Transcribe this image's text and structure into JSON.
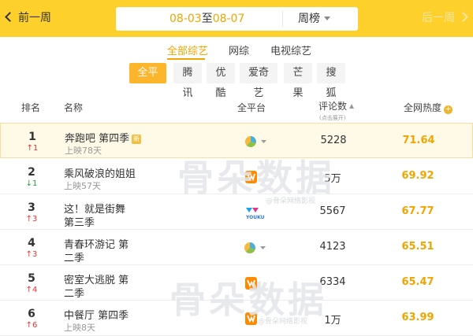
{
  "header": {
    "prev_label": "前一周",
    "next_label": "后一周",
    "date_start": "08-03",
    "date_sep": "至",
    "date_end": "08-07",
    "period_label": "周榜"
  },
  "category_tabs": [
    {
      "label": "全部综艺",
      "active": true
    },
    {
      "label": "网综",
      "active": false
    },
    {
      "label": "电视综艺",
      "active": false
    }
  ],
  "platforms": [
    {
      "label": "全平台",
      "active": true
    },
    {
      "label": "腾讯",
      "active": false
    },
    {
      "label": "优酷",
      "active": false
    },
    {
      "label": "爱奇艺",
      "active": false
    },
    {
      "label": "芒果",
      "active": false
    },
    {
      "label": "搜狐",
      "active": false
    }
  ],
  "table": {
    "headers": {
      "rank": "排名",
      "name": "名称",
      "platform": "全平台",
      "reviews": "评论数",
      "reviews_note": "(点击展开)",
      "heat": "全网热度"
    },
    "rows": [
      {
        "rank": "1",
        "delta": "1",
        "delta_dir": "up",
        "name": "奔跑吧 第四季",
        "name_line2": "",
        "badge": "新",
        "sub": "上映78天",
        "platform_icon": "multi-platform-icon",
        "reviews": "5228",
        "heat": "71.64"
      },
      {
        "rank": "2",
        "delta": "1",
        "delta_dir": "down",
        "name": "乘风破浪的姐姐",
        "name_line2": "",
        "badge": "",
        "sub": "上映57天",
        "platform_icon": "mango-tv-icon",
        "reviews": "5万",
        "heat": "69.92"
      },
      {
        "rank": "3",
        "delta": "3",
        "delta_dir": "up",
        "name": "这！就是街舞",
        "name_line2": "第三季",
        "badge": "",
        "sub": "",
        "platform_icon": "youku-icon",
        "reviews": "5567",
        "heat": "67.77"
      },
      {
        "rank": "4",
        "delta": "3",
        "delta_dir": "up",
        "name": "青春环游记 第",
        "name_line2": "二季",
        "badge": "",
        "sub": "",
        "platform_icon": "multi-platform-icon",
        "reviews": "4123",
        "heat": "65.51"
      },
      {
        "rank": "5",
        "delta": "4",
        "delta_dir": "up",
        "name": "密室大逃脱 第",
        "name_line2": "二季",
        "badge": "",
        "sub": "",
        "platform_icon": "mango-tv-icon",
        "reviews": "6334",
        "heat": "65.47"
      },
      {
        "rank": "6",
        "delta": "6",
        "delta_dir": "up",
        "name": "中餐厅 第四季",
        "name_line2": "",
        "badge": "",
        "sub": "上映8天",
        "platform_icon": "mango-tv-icon",
        "reviews": "1万",
        "heat": "63.99"
      }
    ]
  },
  "watermark": {
    "text": "骨朵数据",
    "sub": "@骨朵网络影视"
  },
  "colors": {
    "header_bg": "#fdd02b",
    "accent": "#f0a500",
    "up": "#e33333",
    "down": "#2a9a3a"
  }
}
